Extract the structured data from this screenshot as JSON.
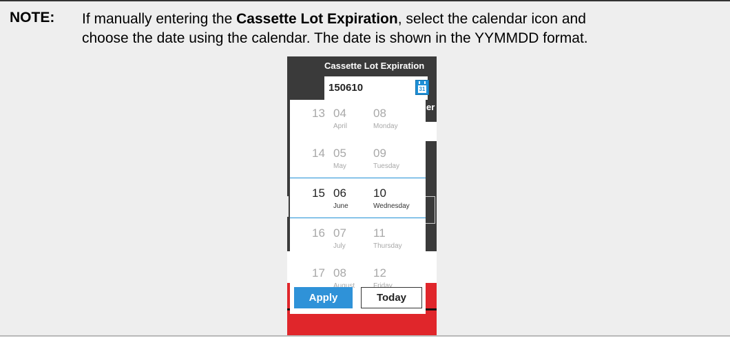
{
  "note": {
    "label": "NOTE:",
    "line1_prefix": "If manually entering the ",
    "line1_bold": "Cassette Lot Expiration",
    "line1_suffix": ", select the calendar icon and",
    "line2": "choose the date using the calendar. The date is shown in the YYMMDD format."
  },
  "screenshot": {
    "field_label": "Cassette Lot Expiration",
    "field_value": "150610",
    "calendar_icon": {
      "name": "calendar-icon",
      "text": "31",
      "color": "#1e8fd6"
    },
    "background_fragment": "er",
    "picker_rows": [
      {
        "year": "13",
        "month": "04",
        "month_name": "April",
        "day": "08",
        "day_name": "Monday",
        "selected": false
      },
      {
        "year": "14",
        "month": "05",
        "month_name": "May",
        "day": "09",
        "day_name": "Tuesday",
        "selected": false
      },
      {
        "year": "15",
        "month": "06",
        "month_name": "June",
        "day": "10",
        "day_name": "Wednesday",
        "selected": true
      },
      {
        "year": "16",
        "month": "07",
        "month_name": "July",
        "day": "11",
        "day_name": "Thursday",
        "selected": false
      },
      {
        "year": "17",
        "month": "08",
        "month_name": "August",
        "day": "12",
        "day_name": "Friday",
        "selected": false
      }
    ],
    "apply_label": "Apply",
    "today_label": "Today",
    "colors": {
      "accent": "#2f92d8",
      "dark": "#3a3a3a",
      "red": "#e0262b"
    }
  }
}
